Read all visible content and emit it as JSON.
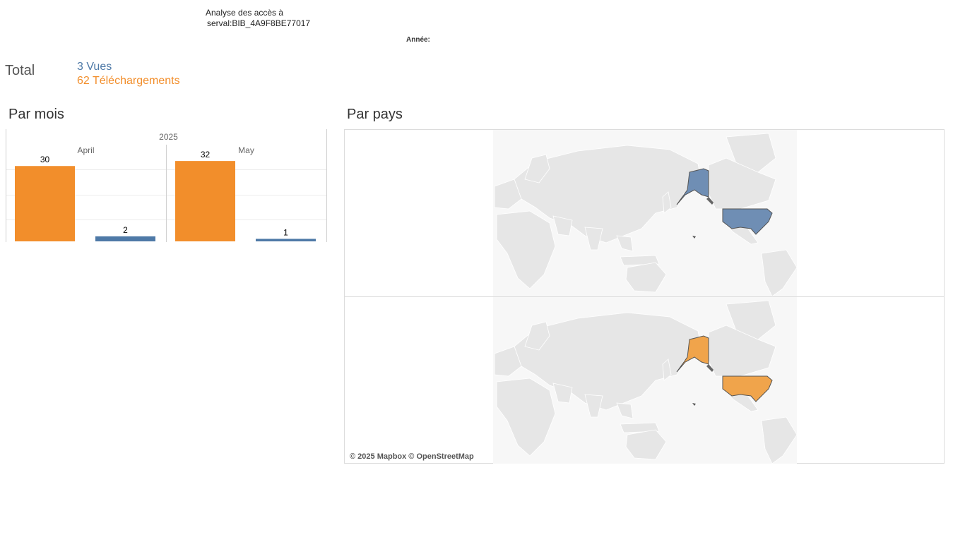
{
  "header": {
    "title_line1": "Analyse des accès à",
    "title_line2": "serval:BIB_4A9F8BE77017",
    "year_filter_label": "Année:"
  },
  "totals": {
    "label": "Total",
    "views": "3 Vues",
    "downloads": "62 Téléchargements"
  },
  "by_month": {
    "title": "Par mois"
  },
  "by_country": {
    "title": "Par pays",
    "attribution": "© 2025 Mapbox © OpenStreetMap",
    "maps": [
      {
        "measure": "views",
        "highlighted": [
          "United States"
        ],
        "color": "#6f8eb4"
      },
      {
        "measure": "downloads",
        "highlighted": [
          "United States"
        ],
        "color": "#f0a44b"
      }
    ]
  },
  "colors": {
    "downloads": "#f28e2b",
    "views": "#4e79a7",
    "map_views": "#6f8eb4",
    "map_downloads": "#f0a44b",
    "land": "#e6e6e6"
  },
  "chart_data": {
    "type": "bar",
    "year": "2025",
    "categories": [
      "April",
      "May"
    ],
    "series": [
      {
        "name": "",
        "measure": "downloads",
        "values": [
          30,
          32
        ],
        "color": "#f28e2b"
      },
      {
        "name": "",
        "measure": "views",
        "values": [
          2,
          1
        ],
        "color": "#4e79a7"
      }
    ],
    "data_labels": [
      "30",
      "2",
      "32",
      "1"
    ],
    "ylim": [
      0,
      34
    ],
    "grid": true,
    "legend": "none"
  }
}
